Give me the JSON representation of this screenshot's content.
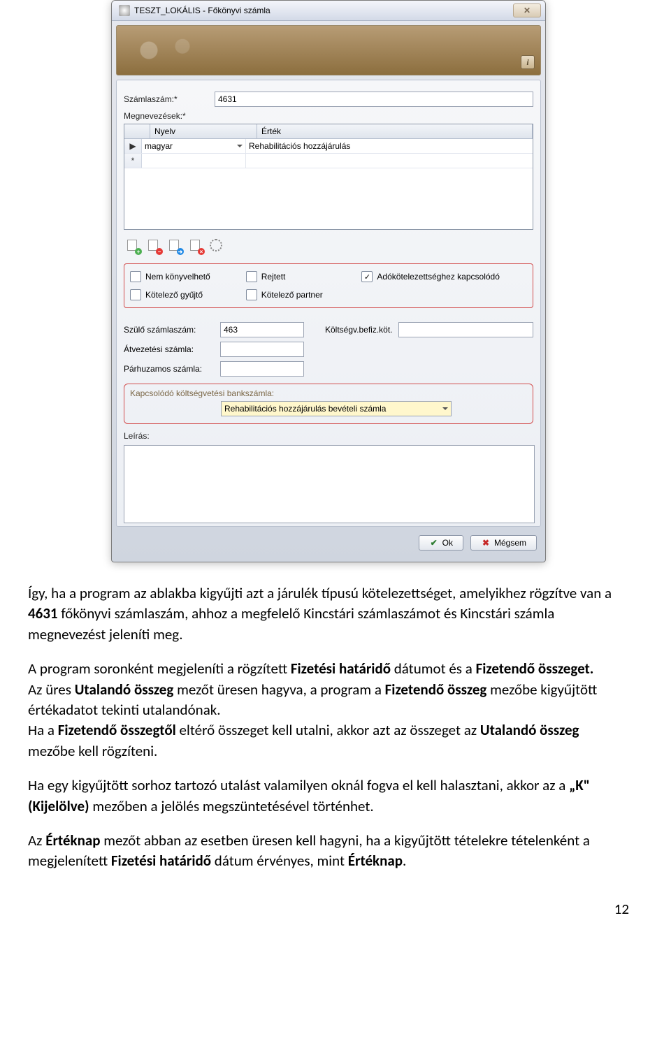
{
  "window": {
    "title": "TESZT_LOKÁLIS - Főkönyvi számla",
    "close_glyph": "✕",
    "info_glyph": "i"
  },
  "form": {
    "szamlaszam_label": "Számlaszám:*",
    "szamlaszam_value": "4631",
    "megnevezesek_label": "Megnevezések:*",
    "grid": {
      "col_nyelv": "Nyelv",
      "col_ertek": "Érték",
      "marker_current": "▶",
      "marker_new": "*",
      "row1_nyelv": "magyar",
      "row1_ertek": "Rehabilitációs hozzájárulás"
    },
    "iconstrip": {
      "add": "doc-add-icon",
      "delete": "doc-delete-icon",
      "refresh": "doc-refresh-icon",
      "remove": "doc-remove-icon",
      "settings": "gear-icon"
    },
    "checks": {
      "c1": "Nem könyvelhető",
      "c2": "Rejtett",
      "c3": "Adókötelezettséghez kapcsolódó",
      "c4": "Kötelező gyűjtő",
      "c5": "Kötelező partner"
    },
    "szulo_label": "Szülő számlaszám:",
    "szulo_value": "463",
    "koltseg_label": "Költségv.befiz.köt.",
    "atvezetesi_label": "Átvezetési számla:",
    "atvezetesi_value": "",
    "parhuzamos_label": "Párhuzamos számla:",
    "parhuzamos_value": "",
    "kapcsolodo_label": "Kapcsolódó költségvetési bankszámla:",
    "kapcsolodo_value": "Rehabilitációs hozzájárulás bevételi számla",
    "leiras_label": "Leírás:"
  },
  "buttons": {
    "ok": "Ok",
    "cancel": "Mégsem"
  },
  "doc": {
    "p1a": "Így, ha a program az ablakba kigyűjti azt a járulék típusú kötelezettséget, amelyikhez rögzítve van a ",
    "p1b": "4631",
    "p1c": " főkönyvi számlaszám, ahhoz a megfelelő Kincstári számlaszámot és Kincstári számla megnevezést jeleníti meg.",
    "p2a": "A program soronként megjeleníti a rögzített ",
    "p2b": "Fizetési határidő",
    "p2c": " dátumot és a ",
    "p2d": "Fizetendő összeget.",
    "p3a": "Az üres ",
    "p3b": "Utalandó összeg",
    "p3c": " mezőt üresen hagyva, a program a ",
    "p3d": "Fizetendő összeg",
    "p3e": " mezőbe kigyűjtött értékadatot tekinti utalandónak.",
    "p4a": "Ha a ",
    "p4b": "Fizetendő összegtől",
    "p4c": " eltérő összeget kell utalni, akkor azt az összeget az ",
    "p4d": "Utalandó összeg",
    "p4e": " mezőbe kell rögzíteni.",
    "p5a": "Ha egy kigyűjtött sorhoz tartozó utalást valamilyen oknál fogva el kell halasztani, akkor az a ",
    "p5b": "„K\" (Kijelölve)",
    "p5c": " mezőben a jelölés megszüntetésével történhet.",
    "p6a": "Az ",
    "p6b": "Értéknap",
    "p6c": " mezőt abban az esetben üresen kell hagyni, ha a kigyűjtött tételekre tételenként a megjelenített ",
    "p6d": "Fizetési határidő",
    "p6e": " dátum érvényes, mint ",
    "p6f": "Értéknap",
    "p6g": ".",
    "pagenum": "12"
  }
}
